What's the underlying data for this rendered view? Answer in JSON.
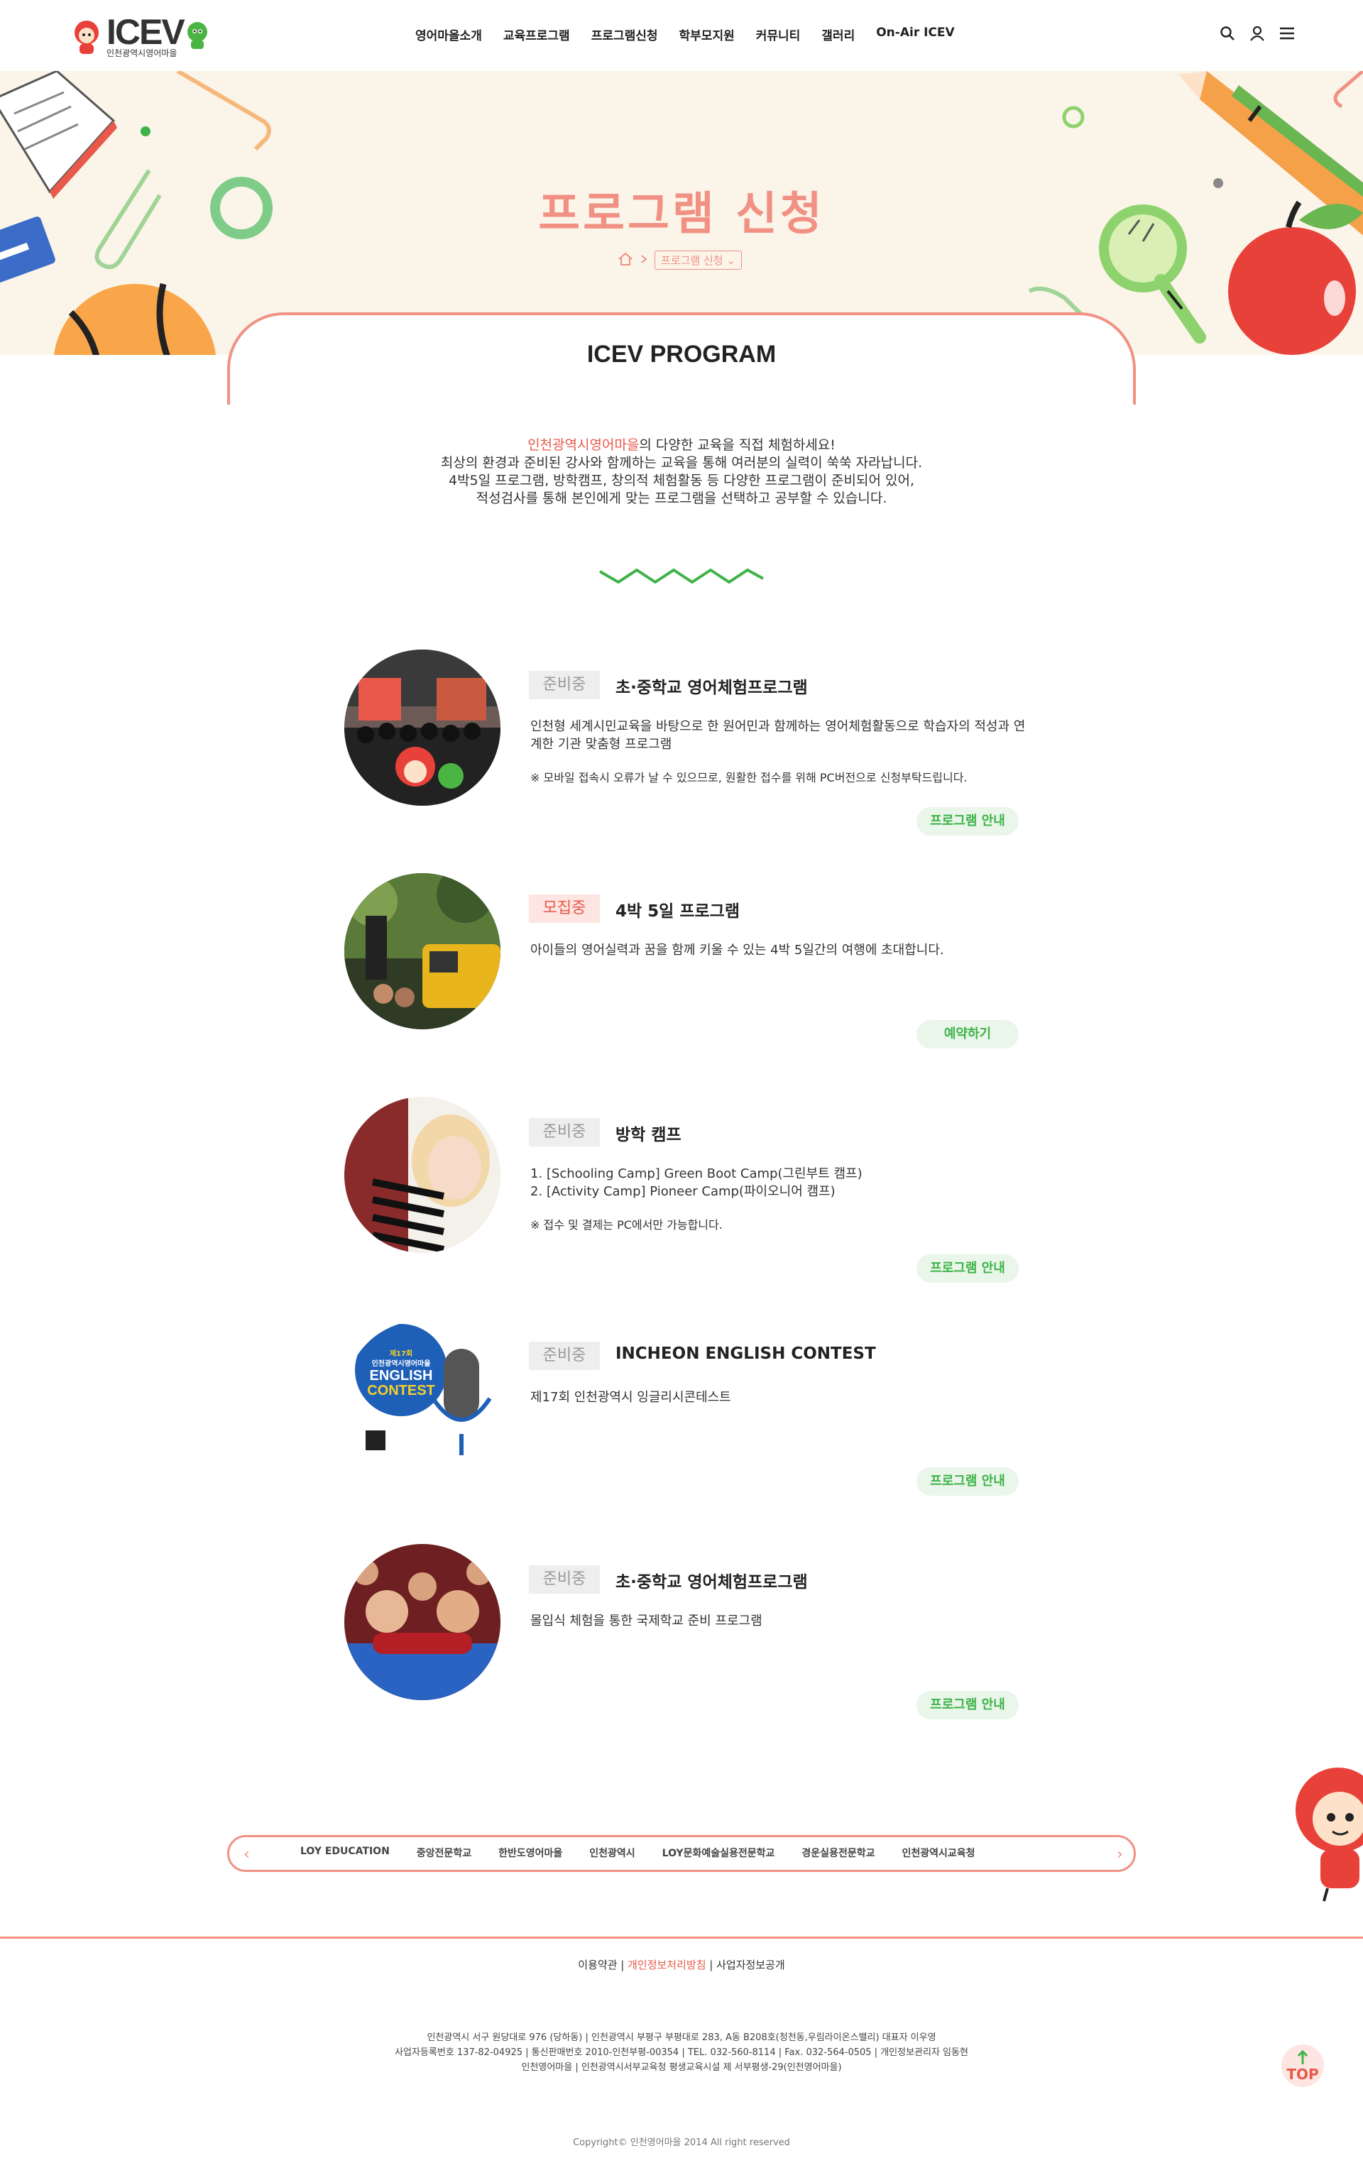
{
  "header": {
    "logo_text": "ICEV",
    "logo_sub": "인천광역시영어마을",
    "nav": [
      "영어마을소개",
      "교육프로그램",
      "프로그램신청",
      "학부모지원",
      "커뮤니티",
      "갤러리",
      "On-Air ICEV"
    ]
  },
  "hero": {
    "title": "프로그램 신청",
    "breadcrumb_select": "프로그램 신청"
  },
  "section": {
    "title": "ICEV PROGRAM",
    "intro_highlight": "인천광역시영어마을",
    "intro_line1_rest": "의 다양한 교육을 직접 체험하세요!",
    "intro_line2": "최상의 환경과 준비된 강사와 함께하는 교육을 통해 여러분의 실력이 쑥쑥 자라납니다.",
    "intro_line3": "4박5일 프로그램, 방학캠프, 창의적 체험활동 등 다양한 프로그램이 준비되어 있어,",
    "intro_line4": "적성검사를 통해 본인에게 맞는 프로그램을 선택하고 공부할 수 있습니다."
  },
  "programs": [
    {
      "status": "준비중",
      "title": "초·중학교 영어체험프로그램",
      "desc": "인천형 세계시민교육을 바탕으로 한 원어민과 함께하는 영어체험활동으로 학습자의 적성과 연계한 기관 맞춤형 프로그램",
      "note": "※ 모바일 접속시 오류가 날 수 있으므로, 원활한 접수를 위해 PC버전으로 신청부탁드립니다.",
      "button": "프로그램 안내"
    },
    {
      "status": "모집중",
      "title": "4박 5일 프로그램",
      "desc": "아이들의 영어실력과 꿈을 함께 키울 수 있는 4박 5일간의 여행에 초대합니다.",
      "note": "",
      "button": "예약하기"
    },
    {
      "status": "준비중",
      "title": "방학 캠프",
      "desc_line1": "1. [Schooling Camp] Green Boot Camp(그린부트 캠프)",
      "desc_line2": "2. [Activity Camp] Pioneer Camp(파이오니어 캠프)",
      "note": "※ 접수 및 결제는 PC에서만 가능합니다.",
      "button": "프로그램 안내"
    },
    {
      "status": "준비중",
      "title": "INCHEON ENGLISH CONTEST",
      "desc": "제17회 인천광역시 잉글리시콘테스트",
      "note": "",
      "button": "프로그램 안내",
      "poster_line1": "제17회",
      "poster_line2": "인천광역시영어마을",
      "poster_line3": "ENGLISH",
      "poster_line4": "CONTEST"
    },
    {
      "status": "준비중",
      "title": "초·중학교 영어체험프로그램",
      "desc": "몰입식 체험을 통한 국제학교 준비 프로그램",
      "note": "",
      "button": "프로그램 안내"
    }
  ],
  "partners": [
    "LOY EDUCATION",
    "중앙전문학교",
    "한반도영어마을",
    "인천광역시",
    "LOY문화예술실용전문학교",
    "경운실용전문학교",
    "인천광역시교육청"
  ],
  "footer": {
    "link1": "이용약관",
    "link2": "개인정보처리방침",
    "link3": "사업자정보공개",
    "sep": " | ",
    "info1": "인천광역시 서구 원당대로 976 (당하동) | 인천광역시 부평구 부평대로 283, A동 B208호(청천동,우림라이온스밸리) 대표자 이우영",
    "info2": "사업자등록번호 137-82-04925 | 통신판매번호 2010-인천부평-00354 | TEL. 032-560-8114 | Fax. 032-564-0505 | 개인정보관리자 임동현",
    "info3": "인천영어마을 | 인천광역시서부교육청 평생교육시설 제 서부평생-29(인천영어마을)",
    "copyright": "Copyright© 인천영어마을 2014 All right reserved",
    "top": "TOP"
  }
}
